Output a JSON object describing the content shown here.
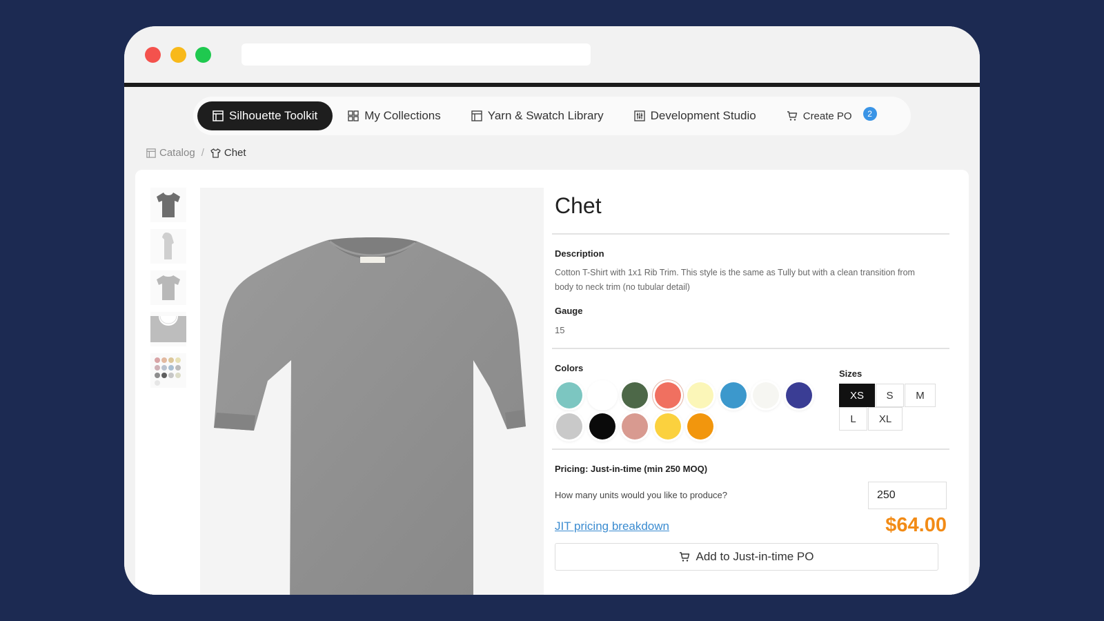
{
  "nav": {
    "items": [
      {
        "label": "Silhouette Toolkit"
      },
      {
        "label": "My Collections"
      },
      {
        "label": "Yarn & Swatch Library"
      },
      {
        "label": "Development Studio"
      },
      {
        "label": "Create PO"
      }
    ],
    "cart_count": "2"
  },
  "breadcrumb": {
    "root": "Catalog",
    "separator": "/",
    "current": "Chet"
  },
  "product": {
    "title": "Chet",
    "description_label": "Description",
    "description": "Cotton T-Shirt with 1x1 Rib Trim. This style is the same as Tully but with a clean transition from body to neck trim (no tubular detail)",
    "gauge_label": "Gauge",
    "gauge_value": "15",
    "colors_label": "Colors",
    "colors": [
      "#7cc6c1",
      "#ffffff",
      "#4d6848",
      "#f07060",
      "#fbf6b8",
      "#3c98cc",
      "#f6f6f2",
      "#3a3d94",
      "#c9c9c9",
      "#0a0a0a",
      "#d89a90",
      "#fbd13e",
      "#f2960d"
    ],
    "selected_color": "#f07060",
    "sizes_label": "Sizes",
    "sizes": [
      "XS",
      "S",
      "M",
      "L",
      "XL"
    ],
    "selected_size": "XS",
    "pricing_label": "Pricing: Just-in-time (min 250 MOQ)",
    "units_question": "How many units would you like to produce?",
    "units_value": "250",
    "pricing_link": "JIT pricing breakdown",
    "price": "$64.00",
    "add_button": "Add to Just-in-time PO"
  }
}
